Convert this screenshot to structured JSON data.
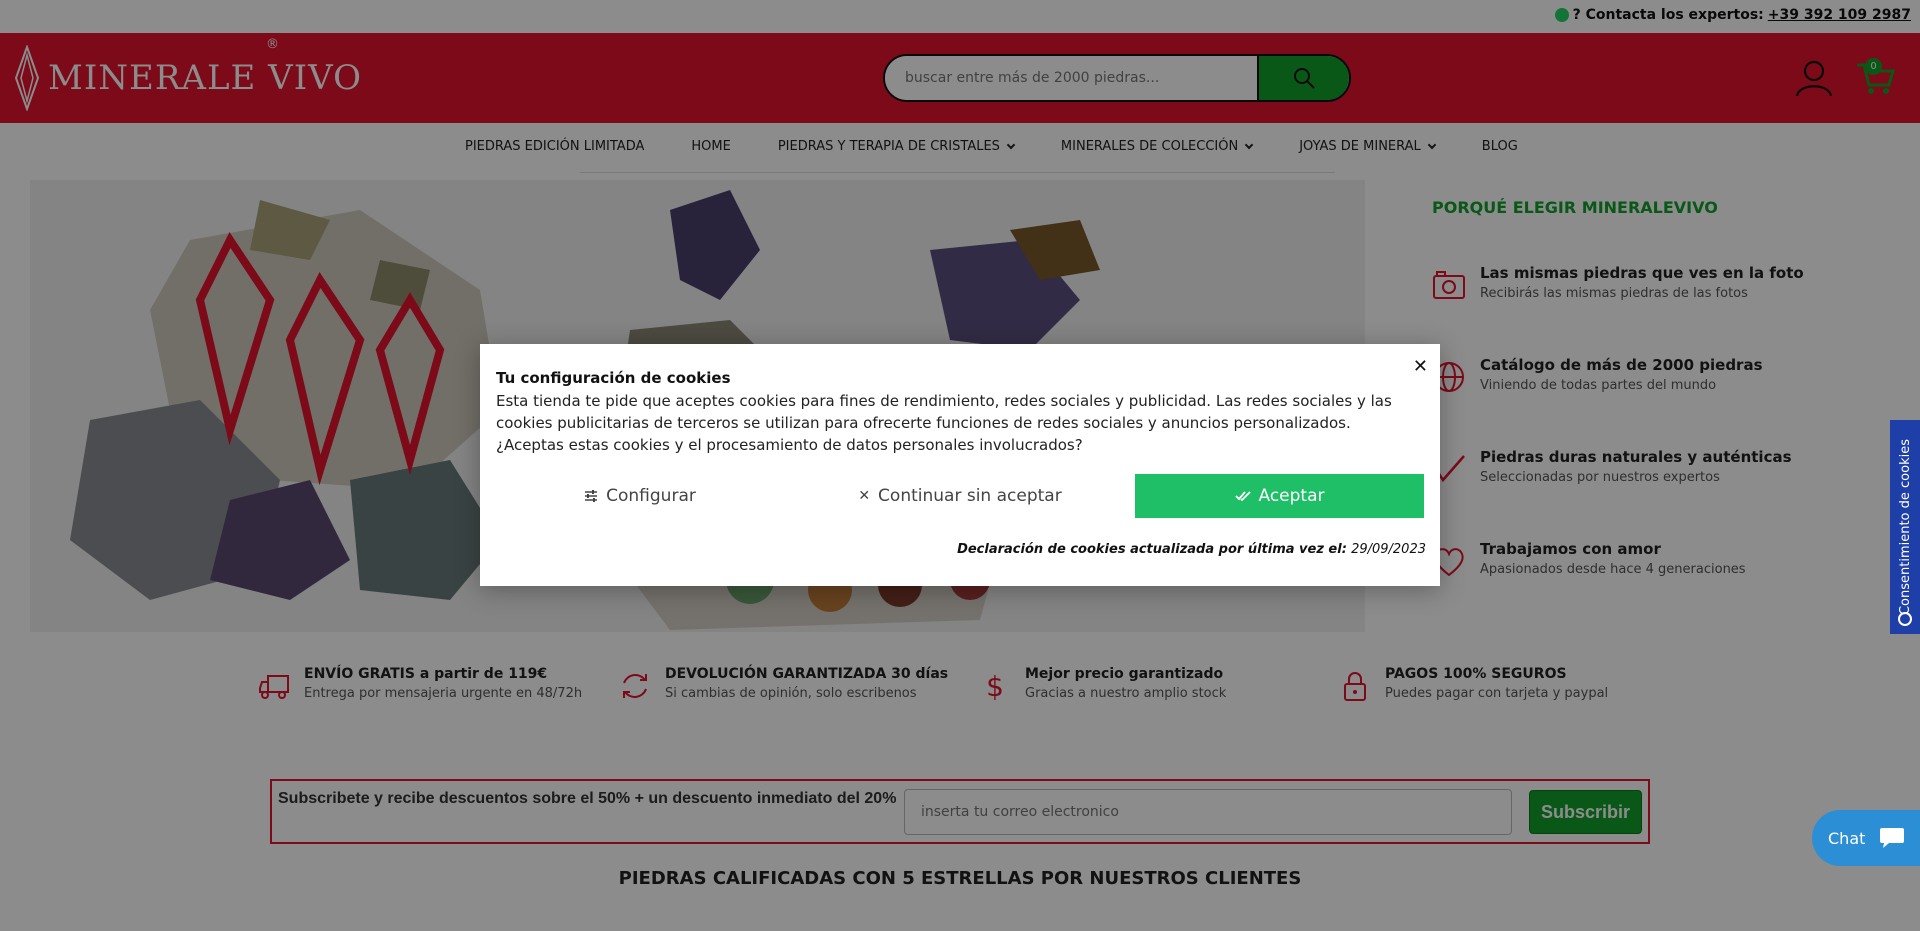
{
  "topbar": {
    "contact_label": "? Contacta los expertos:",
    "phone": "+39 392 109 2987"
  },
  "header": {
    "logo_text": "MINERALE VIVO",
    "logo_registered": "®",
    "search_placeholder": "buscar entre más de 2000 piedras...",
    "cart_count": "0"
  },
  "nav": {
    "items": [
      {
        "label": "PIEDRAS EDICIÓN LIMITADA",
        "dropdown": false
      },
      {
        "label": "HOME",
        "dropdown": false
      },
      {
        "label": "PIEDRAS Y TERAPIA DE CRISTALES",
        "dropdown": true
      },
      {
        "label": "MINERALES DE COLECCIÓN",
        "dropdown": true
      },
      {
        "label": "JOYAS DE MINERAL",
        "dropdown": true
      },
      {
        "label": "BLOG",
        "dropdown": false
      }
    ]
  },
  "why": {
    "title": "PORQUÉ ELEGIR MINERALEVIVO",
    "items": [
      {
        "icon": "camera-icon",
        "title": "Las mismas piedras que ves en la foto",
        "subtitle": "Recibirás las mismas piedras de las fotos"
      },
      {
        "icon": "globe-icon",
        "title": "Catálogo de más de 2000 piedras",
        "subtitle": "Viniendo de todas partes del mundo"
      },
      {
        "icon": "check-icon",
        "title": "Piedras duras naturales y auténticas",
        "subtitle": "Seleccionadas por nuestros expertos"
      },
      {
        "icon": "heart-icon",
        "title": "Trabajamos con amor",
        "subtitle": "Apasionados desde hace 4 generaciones"
      }
    ]
  },
  "benefits": [
    {
      "icon": "truck-icon",
      "title": "ENVÍO GRATIS a partir de 119€",
      "subtitle": "Entrega por mensajeria urgente en 48/72h"
    },
    {
      "icon": "refresh-icon",
      "title": "DEVOLUCIÓN GARANTIZADA 30 días",
      "subtitle": "Si cambias de opinión, solo escribenos"
    },
    {
      "icon": "dollar-icon",
      "title": "Mejor precio garantizado",
      "subtitle": "Gracias a nuestro amplio stock"
    },
    {
      "icon": "lock-icon",
      "title": "PAGOS 100% SEGUROS",
      "subtitle": "Puedes pagar con tarjeta y paypal"
    }
  ],
  "subscribe": {
    "label": "Subscribete y recibe descuentos sobre el 50% + un descuento inmediato del 20%",
    "placeholder": "inserta tu correo electronico",
    "button": "Subscribir"
  },
  "rated_title": "PIEDRAS CALIFICADAS CON 5 ESTRELLAS POR NUESTROS CLIENTES",
  "side_tab": "Consentimiento de cookies",
  "chat": "Chat",
  "cookie_modal": {
    "title": "Tu configuración de cookies",
    "body": "Esta tienda te pide que aceptes cookies para fines de rendimiento, redes sociales y publicidad. Las redes sociales y las cookies publicitarias de terceros se utilizan para ofrecerte funciones de redes sociales y anuncios personalizados. ¿Aceptas estas cookies y el procesamiento de datos personales involucrados?",
    "btn_config": "Configurar",
    "btn_no_accept": "Continuar sin aceptar",
    "btn_accept": "Aceptar",
    "updated_label": "Declaración de cookies actualizada por última vez el:",
    "updated_date": "29/09/2023"
  },
  "colors": {
    "brand_red": "#e2132e",
    "brand_green": "#12a02a",
    "accept_green": "#1fbf67",
    "side_tab_blue": "#1e3ea8",
    "chat_blue": "#2c8fd6"
  }
}
